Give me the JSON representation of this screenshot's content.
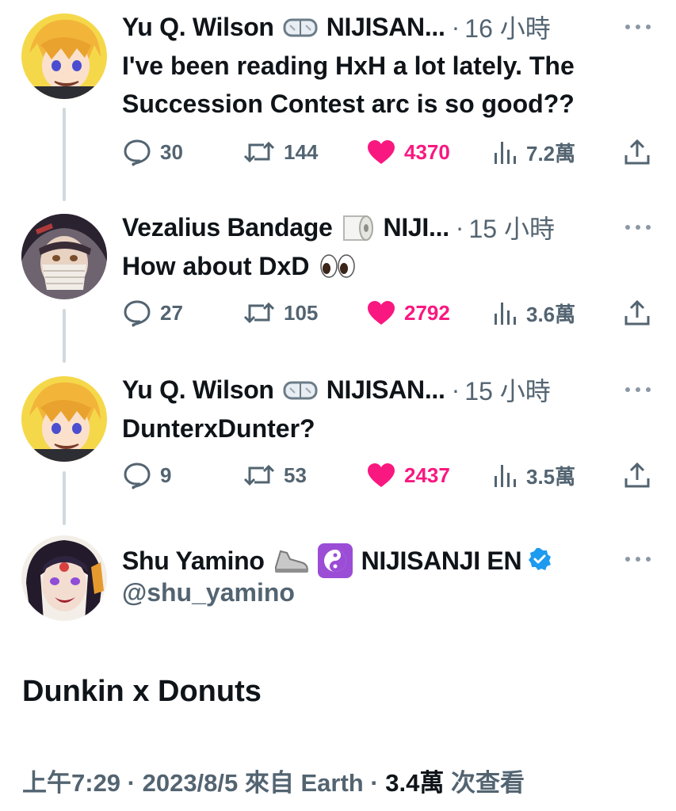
{
  "replies": [
    {
      "name": "Yu Q. Wilson",
      "emoji": "goggles-icon",
      "name_suffix": "NIJISAN...",
      "time": "16 小時",
      "text_lines": [
        "I've been reading HxH a lot lately. The",
        "Succession Contest arc is so good??"
      ],
      "comments": "30",
      "retweets": "144",
      "likes": "4370",
      "views": "7.2萬"
    },
    {
      "name": "Vezalius Bandage",
      "emoji": "toilet-paper-icon",
      "name_suffix": "NIJI...",
      "time": "15 小時",
      "text_lines": [
        "How about DxD"
      ],
      "comments": "27",
      "retweets": "105",
      "likes": "2792",
      "views": "3.6萬"
    },
    {
      "name": "Yu Q. Wilson",
      "emoji": "goggles-icon",
      "name_suffix": "NIJISAN...",
      "time": "15 小時",
      "text_lines": [
        "DunterxDunter?"
      ],
      "comments": "9",
      "retweets": "53",
      "likes": "2437",
      "views": "3.5萬"
    }
  ],
  "main": {
    "name": "Shu Yamino",
    "name_suffix": "NIJISANJI EN",
    "handle": "@shu_yamino",
    "text": "Dunkin x Donuts",
    "meta_time": "上午7:29 · 2023/8/5 來自 Earth · ",
    "meta_views": "3.4萬",
    "meta_views_label": " 次查看"
  },
  "colors": {
    "like": "#f91880",
    "muted": "#536471",
    "verified": "#1d9bf0",
    "thread_line": "#cfd9de"
  }
}
